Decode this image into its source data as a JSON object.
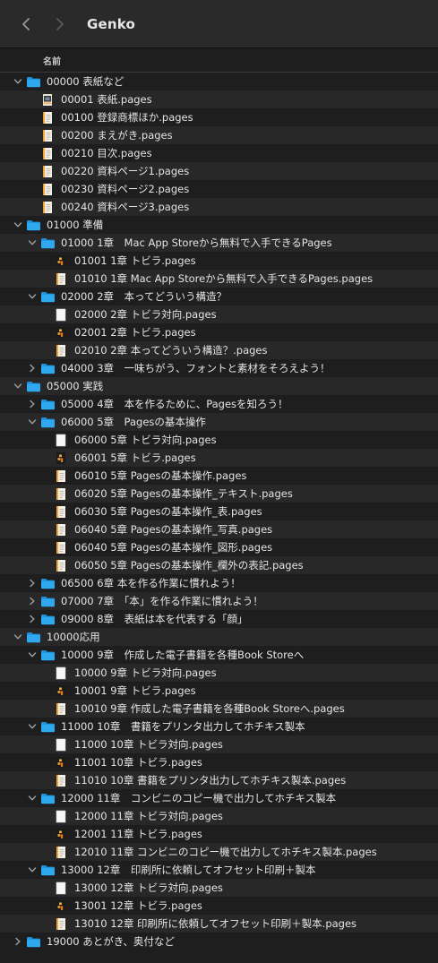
{
  "window": {
    "title": "Genko",
    "column_header": "名前"
  },
  "rows": [
    {
      "label": "00000 表紙など",
      "type": "folder",
      "depth": 0,
      "disc": "open"
    },
    {
      "label": "00001 表紙.pages",
      "type": "doc-cover",
      "depth": 1
    },
    {
      "label": "00100 登録商標ほか.pages",
      "type": "doc-orange",
      "depth": 1
    },
    {
      "label": "00200 まえがき.pages",
      "type": "doc-orange",
      "depth": 1
    },
    {
      "label": "00210 目次.pages",
      "type": "doc-orange",
      "depth": 1
    },
    {
      "label": "00220 資料ページ1.pages",
      "type": "doc-orange",
      "depth": 1
    },
    {
      "label": "00230 資料ページ2.pages",
      "type": "doc-orange",
      "depth": 1
    },
    {
      "label": "00240 資料ページ3.pages",
      "type": "doc-orange",
      "depth": 1
    },
    {
      "label": "01000 準備",
      "type": "folder",
      "depth": 0,
      "disc": "open"
    },
    {
      "label": "01000 1章　Mac App Storeから無料で入手できるPages",
      "type": "folder",
      "depth": 1,
      "disc": "open"
    },
    {
      "label": "01001 1章 トビラ.pages",
      "type": "doc-dark",
      "depth": 2
    },
    {
      "label": "01010 1章 Mac App Storeから無料で入手できるPages.pages",
      "type": "doc-orange",
      "depth": 2
    },
    {
      "label": "02000 2章　本ってどういう構造？",
      "type": "folder",
      "depth": 1,
      "disc": "open"
    },
    {
      "label": "02000 2章 トビラ対向.pages",
      "type": "doc-white",
      "depth": 2
    },
    {
      "label": "02001 2章 トビラ.pages",
      "type": "doc-dark",
      "depth": 2
    },
    {
      "label": "02010 2章 本ってどういう構造？.pages",
      "type": "doc-orange",
      "depth": 2
    },
    {
      "label": "04000 3章　一味ちがう、フォントと素材をそろえよう！",
      "type": "folder",
      "depth": 1,
      "disc": "closed"
    },
    {
      "label": "05000 実践",
      "type": "folder",
      "depth": 0,
      "disc": "open"
    },
    {
      "label": "05000 4章　本を作るために、Pagesを知ろう！",
      "type": "folder",
      "depth": 1,
      "disc": "closed"
    },
    {
      "label": "06000 5章　Pagesの基本操作",
      "type": "folder",
      "depth": 1,
      "disc": "open"
    },
    {
      "label": "06000 5章 トビラ対向.pages",
      "type": "doc-white",
      "depth": 2
    },
    {
      "label": "06001 5章 トビラ.pages",
      "type": "doc-dark",
      "depth": 2
    },
    {
      "label": "06010 5章 Pagesの基本操作.pages",
      "type": "doc-orange",
      "depth": 2
    },
    {
      "label": "06020 5章 Pagesの基本操作_テキスト.pages",
      "type": "doc-orange",
      "depth": 2
    },
    {
      "label": "06030 5章 Pagesの基本操作_表.pages",
      "type": "doc-orange",
      "depth": 2
    },
    {
      "label": "06040 5章 Pagesの基本操作_写真.pages",
      "type": "doc-orange",
      "depth": 2
    },
    {
      "label": "06040 5章 Pagesの基本操作_図形.pages",
      "type": "doc-orange",
      "depth": 2
    },
    {
      "label": "06050 5章 Pagesの基本操作_欄外の表記.pages",
      "type": "doc-orange",
      "depth": 2
    },
    {
      "label": "06500 6章 本を作る作業に慣れよう！",
      "type": "folder",
      "depth": 1,
      "disc": "closed"
    },
    {
      "label": "07000 7章　「本」を作る作業に慣れよう！",
      "type": "folder",
      "depth": 1,
      "disc": "closed"
    },
    {
      "label": "09000 8章　表紙は本を代表する「顔」",
      "type": "folder",
      "depth": 1,
      "disc": "closed"
    },
    {
      "label": "10000応用",
      "type": "folder",
      "depth": 0,
      "disc": "open"
    },
    {
      "label": "10000 9章　作成した電子書籍を各種Book Storeへ",
      "type": "folder",
      "depth": 1,
      "disc": "open"
    },
    {
      "label": "10000 9章 トビラ対向.pages",
      "type": "doc-white",
      "depth": 2
    },
    {
      "label": "10001 9章 トビラ.pages",
      "type": "doc-dark",
      "depth": 2
    },
    {
      "label": "10010 9章 作成した電子書籍を各種Book Storeへ.pages",
      "type": "doc-orange",
      "depth": 2
    },
    {
      "label": "11000 10章　書籍をプリンタ出力してホチキス製本",
      "type": "folder",
      "depth": 1,
      "disc": "open"
    },
    {
      "label": "11000 10章 トビラ対向.pages",
      "type": "doc-white",
      "depth": 2
    },
    {
      "label": "11001 10章 トビラ.pages",
      "type": "doc-dark",
      "depth": 2
    },
    {
      "label": "11010 10章 書籍をプリンタ出力してホチキス製本.pages",
      "type": "doc-orange",
      "depth": 2
    },
    {
      "label": "12000 11章　コンビニのコピー機で出力してホチキス製本",
      "type": "folder",
      "depth": 1,
      "disc": "open"
    },
    {
      "label": "12000 11章 トビラ対向.pages",
      "type": "doc-white",
      "depth": 2
    },
    {
      "label": "12001 11章 トビラ.pages",
      "type": "doc-dark",
      "depth": 2
    },
    {
      "label": "12010 11章 コンビニのコピー機で出力してホチキス製本.pages",
      "type": "doc-orange",
      "depth": 2
    },
    {
      "label": "13000 12章　印刷所に依頼してオフセット印刷＋製本",
      "type": "folder",
      "depth": 1,
      "disc": "open"
    },
    {
      "label": "13000 12章 トビラ対向.pages",
      "type": "doc-white",
      "depth": 2
    },
    {
      "label": "13001 12章 トビラ.pages",
      "type": "doc-dark",
      "depth": 2
    },
    {
      "label": "13010 12章 印刷所に依頼してオフセット印刷＋製本.pages",
      "type": "doc-orange",
      "depth": 2
    },
    {
      "label": "19000 あとがき、奥付など",
      "type": "folder",
      "depth": 0,
      "disc": "closed"
    }
  ],
  "colors": {
    "folder": "#2fa8f0",
    "folder_tab": "#1f8fd8",
    "accent_orange": "#f2a33a"
  },
  "icons": {
    "back": "chevron-left-icon",
    "forward": "chevron-right-icon",
    "folder": "folder-icon",
    "document": "pages-document-icon",
    "disclosure_open": "chevron-down-icon",
    "disclosure_closed": "chevron-right-icon"
  }
}
